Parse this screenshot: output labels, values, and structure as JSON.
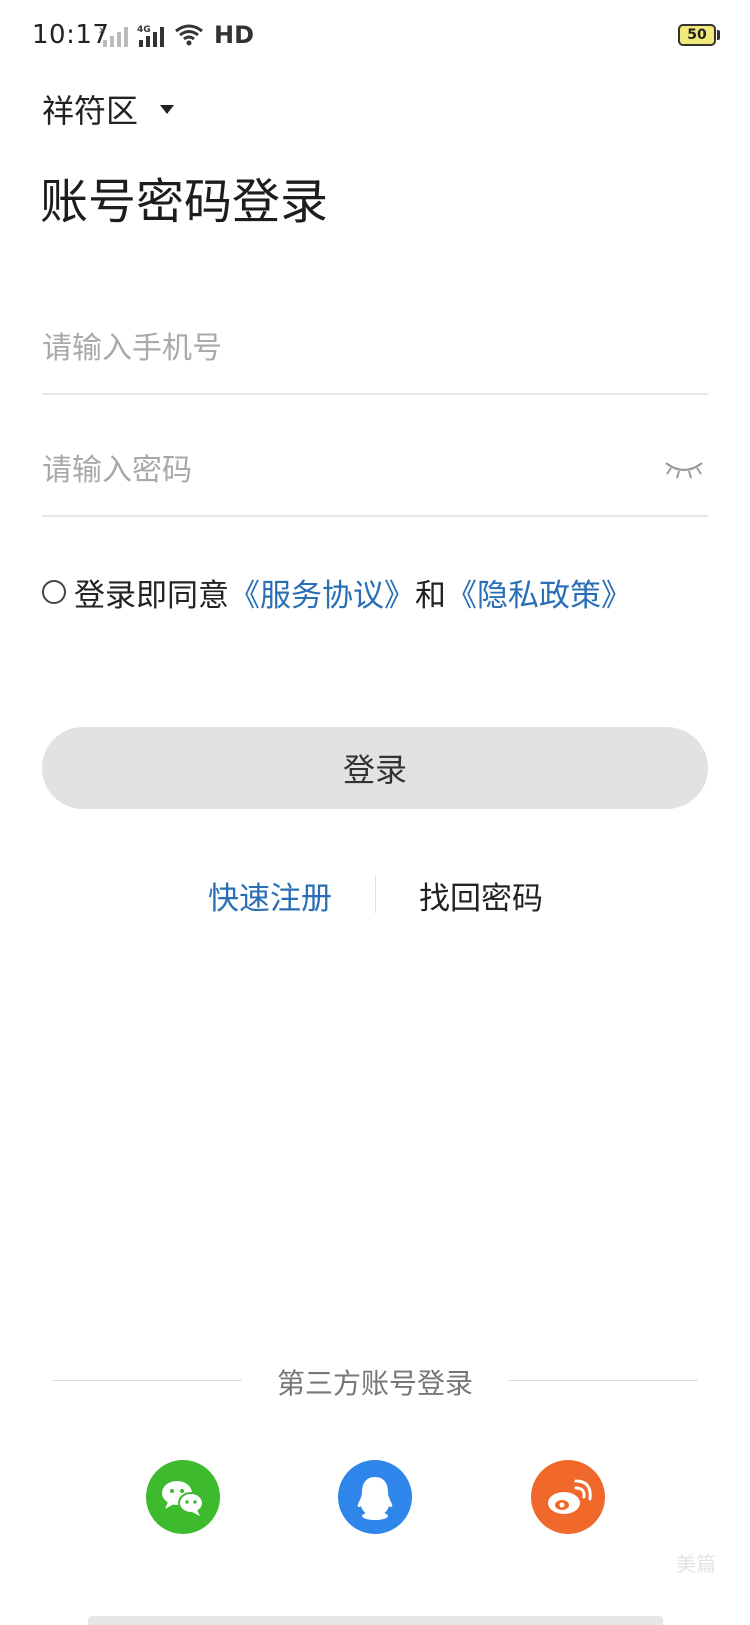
{
  "status_bar": {
    "time": "10:17",
    "network": "4G",
    "hd": "HD",
    "battery": "50"
  },
  "region": {
    "label": "祥符区"
  },
  "title": "账号密码登录",
  "phone_input": {
    "placeholder": "请输入手机号",
    "value": ""
  },
  "password_input": {
    "placeholder": "请输入密码",
    "value": ""
  },
  "agreement": {
    "prefix": "登录即同意",
    "service_link": "《服务协议》",
    "and": "和",
    "privacy_link": "《隐私政策》",
    "checked": false
  },
  "login_button": "登录",
  "links": {
    "register": "快速注册",
    "forgot": "找回密码"
  },
  "third_party": {
    "title": "第三方账号登录",
    "providers": [
      "wechat",
      "qq",
      "weibo"
    ]
  },
  "watermark": "美篇",
  "colors": {
    "link": "#2a6fb5",
    "button_bg": "#e2e2e2",
    "wechat": "#3dba2e",
    "qq": "#2f86ea",
    "weibo": "#f1692a"
  }
}
